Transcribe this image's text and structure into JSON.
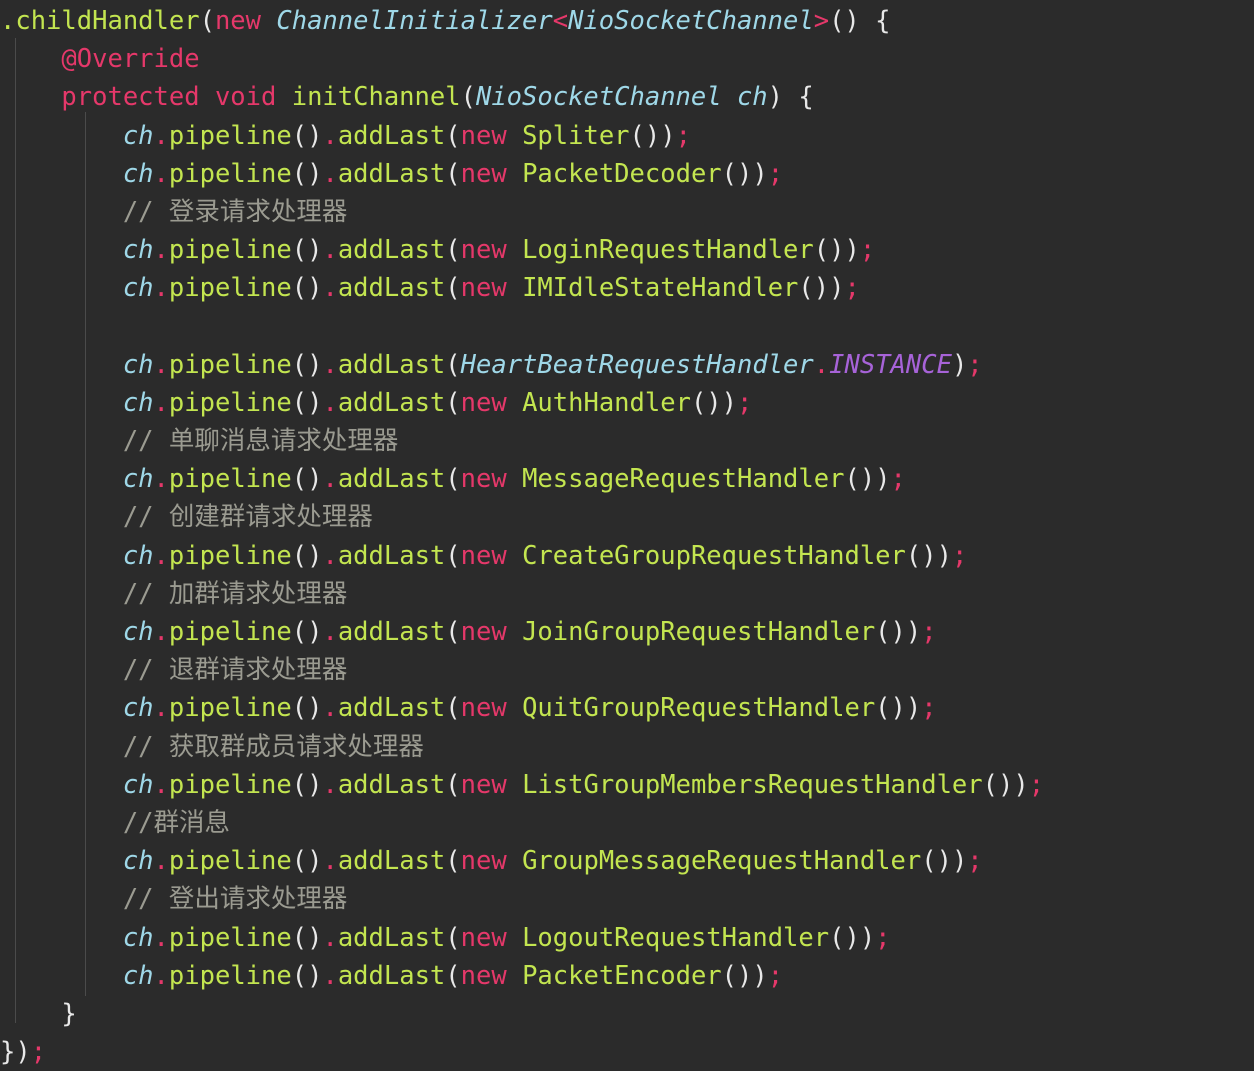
{
  "editor": {
    "theme": "dark",
    "language": "java",
    "background_color": "#2b2b2b",
    "indent_guide_color": "#4b4b4b",
    "colors": {
      "punctuation": "#e8e8e8",
      "keyword": "#e5386a",
      "method": "#c3e550",
      "type": "#9fd8e8",
      "variable": "#9fd8e8",
      "comment": "#9b9b91",
      "constant": "#a763d8",
      "semicolon": "#e5386a"
    }
  },
  "code": {
    "lines": [
      {
        "n": 1,
        "text": ".childHandler(new ChannelInitializer<NioSocketChannel>() {",
        "tokens": [
          {
            "t": ".childHandler",
            "c": "mth"
          },
          {
            "t": "(",
            "c": "pun"
          },
          {
            "t": "new ",
            "c": "kw"
          },
          {
            "t": "ChannelInitializer",
            "c": "typ"
          },
          {
            "t": "<",
            "c": "semi"
          },
          {
            "t": "NioSocketChannel",
            "c": "typ"
          },
          {
            "t": ">",
            "c": "semi"
          },
          {
            "t": "() {",
            "c": "pun"
          }
        ]
      },
      {
        "n": 2,
        "text": "    @Override",
        "tokens": [
          {
            "t": "    ",
            "c": "pun"
          },
          {
            "t": "@Override",
            "c": "ann"
          }
        ]
      },
      {
        "n": 3,
        "text": "    protected void initChannel(NioSocketChannel ch) {",
        "tokens": [
          {
            "t": "    ",
            "c": "pun"
          },
          {
            "t": "protected void ",
            "c": "kw"
          },
          {
            "t": "initChannel",
            "c": "mth"
          },
          {
            "t": "(",
            "c": "pun"
          },
          {
            "t": "NioSocketChannel ch",
            "c": "typ"
          },
          {
            "t": ") {",
            "c": "pun"
          }
        ]
      },
      {
        "n": 4,
        "text": "        ch.pipeline().addLast(new Spliter());",
        "tokens": [
          {
            "t": "        ",
            "c": "pun"
          },
          {
            "t": "ch",
            "c": "var"
          },
          {
            "t": ".",
            "c": "dot"
          },
          {
            "t": "pipeline",
            "c": "mth"
          },
          {
            "t": "()",
            "c": "pun"
          },
          {
            "t": ".",
            "c": "dot"
          },
          {
            "t": "addLast",
            "c": "mth"
          },
          {
            "t": "(",
            "c": "pun"
          },
          {
            "t": "new ",
            "c": "kw"
          },
          {
            "t": "Spliter",
            "c": "mth"
          },
          {
            "t": "())",
            "c": "pun"
          },
          {
            "t": ";",
            "c": "semi"
          }
        ]
      },
      {
        "n": 5,
        "text": "        ch.pipeline().addLast(new PacketDecoder());",
        "tokens": [
          {
            "t": "        ",
            "c": "pun"
          },
          {
            "t": "ch",
            "c": "var"
          },
          {
            "t": ".",
            "c": "dot"
          },
          {
            "t": "pipeline",
            "c": "mth"
          },
          {
            "t": "()",
            "c": "pun"
          },
          {
            "t": ".",
            "c": "dot"
          },
          {
            "t": "addLast",
            "c": "mth"
          },
          {
            "t": "(",
            "c": "pun"
          },
          {
            "t": "new ",
            "c": "kw"
          },
          {
            "t": "PacketDecoder",
            "c": "mth"
          },
          {
            "t": "())",
            "c": "pun"
          },
          {
            "t": ";",
            "c": "semi"
          }
        ]
      },
      {
        "n": 6,
        "text": "        // 登录请求处理器",
        "tokens": [
          {
            "t": "        ",
            "c": "pun"
          },
          {
            "t": "// ",
            "c": "cmt"
          },
          {
            "t": "登录请求处理器",
            "c": "cmt cn-cmt"
          }
        ]
      },
      {
        "n": 7,
        "text": "        ch.pipeline().addLast(new LoginRequestHandler());",
        "tokens": [
          {
            "t": "        ",
            "c": "pun"
          },
          {
            "t": "ch",
            "c": "var"
          },
          {
            "t": ".",
            "c": "dot"
          },
          {
            "t": "pipeline",
            "c": "mth"
          },
          {
            "t": "()",
            "c": "pun"
          },
          {
            "t": ".",
            "c": "dot"
          },
          {
            "t": "addLast",
            "c": "mth"
          },
          {
            "t": "(",
            "c": "pun"
          },
          {
            "t": "new ",
            "c": "kw"
          },
          {
            "t": "LoginRequestHandler",
            "c": "mth"
          },
          {
            "t": "())",
            "c": "pun"
          },
          {
            "t": ";",
            "c": "semi"
          }
        ]
      },
      {
        "n": 8,
        "text": "        ch.pipeline().addLast(new IMIdleStateHandler());",
        "tokens": [
          {
            "t": "        ",
            "c": "pun"
          },
          {
            "t": "ch",
            "c": "var"
          },
          {
            "t": ".",
            "c": "dot"
          },
          {
            "t": "pipeline",
            "c": "mth"
          },
          {
            "t": "()",
            "c": "pun"
          },
          {
            "t": ".",
            "c": "dot"
          },
          {
            "t": "addLast",
            "c": "mth"
          },
          {
            "t": "(",
            "c": "pun"
          },
          {
            "t": "new ",
            "c": "kw"
          },
          {
            "t": "IMIdleStateHandler",
            "c": "mth"
          },
          {
            "t": "())",
            "c": "pun"
          },
          {
            "t": ";",
            "c": "semi"
          }
        ]
      },
      {
        "n": 9,
        "text": "",
        "tokens": []
      },
      {
        "n": 10,
        "text": "        ch.pipeline().addLast(HeartBeatRequestHandler.INSTANCE);",
        "tokens": [
          {
            "t": "        ",
            "c": "pun"
          },
          {
            "t": "ch",
            "c": "var"
          },
          {
            "t": ".",
            "c": "dot"
          },
          {
            "t": "pipeline",
            "c": "mth"
          },
          {
            "t": "()",
            "c": "pun"
          },
          {
            "t": ".",
            "c": "dot"
          },
          {
            "t": "addLast",
            "c": "mth"
          },
          {
            "t": "(",
            "c": "pun"
          },
          {
            "t": "HeartBeatRequestHandler",
            "c": "typ"
          },
          {
            "t": ".",
            "c": "dot"
          },
          {
            "t": "INSTANCE",
            "c": "const"
          },
          {
            "t": ")",
            "c": "pun"
          },
          {
            "t": ";",
            "c": "semi"
          }
        ]
      },
      {
        "n": 11,
        "text": "        ch.pipeline().addLast(new AuthHandler());",
        "tokens": [
          {
            "t": "        ",
            "c": "pun"
          },
          {
            "t": "ch",
            "c": "var"
          },
          {
            "t": ".",
            "c": "dot"
          },
          {
            "t": "pipeline",
            "c": "mth"
          },
          {
            "t": "()",
            "c": "pun"
          },
          {
            "t": ".",
            "c": "dot"
          },
          {
            "t": "addLast",
            "c": "mth"
          },
          {
            "t": "(",
            "c": "pun"
          },
          {
            "t": "new ",
            "c": "kw"
          },
          {
            "t": "AuthHandler",
            "c": "mth"
          },
          {
            "t": "())",
            "c": "pun"
          },
          {
            "t": ";",
            "c": "semi"
          }
        ]
      },
      {
        "n": 12,
        "text": "        // 单聊消息请求处理器",
        "tokens": [
          {
            "t": "        ",
            "c": "pun"
          },
          {
            "t": "// ",
            "c": "cmt"
          },
          {
            "t": "单聊消息请求处理器",
            "c": "cmt cn-cmt"
          }
        ]
      },
      {
        "n": 13,
        "text": "        ch.pipeline().addLast(new MessageRequestHandler());",
        "tokens": [
          {
            "t": "        ",
            "c": "pun"
          },
          {
            "t": "ch",
            "c": "var"
          },
          {
            "t": ".",
            "c": "dot"
          },
          {
            "t": "pipeline",
            "c": "mth"
          },
          {
            "t": "()",
            "c": "pun"
          },
          {
            "t": ".",
            "c": "dot"
          },
          {
            "t": "addLast",
            "c": "mth"
          },
          {
            "t": "(",
            "c": "pun"
          },
          {
            "t": "new ",
            "c": "kw"
          },
          {
            "t": "MessageRequestHandler",
            "c": "mth"
          },
          {
            "t": "())",
            "c": "pun"
          },
          {
            "t": ";",
            "c": "semi"
          }
        ]
      },
      {
        "n": 14,
        "text": "        // 创建群请求处理器",
        "tokens": [
          {
            "t": "        ",
            "c": "pun"
          },
          {
            "t": "// ",
            "c": "cmt"
          },
          {
            "t": "创建群请求处理器",
            "c": "cmt cn-cmt"
          }
        ]
      },
      {
        "n": 15,
        "text": "        ch.pipeline().addLast(new CreateGroupRequestHandler());",
        "tokens": [
          {
            "t": "        ",
            "c": "pun"
          },
          {
            "t": "ch",
            "c": "var"
          },
          {
            "t": ".",
            "c": "dot"
          },
          {
            "t": "pipeline",
            "c": "mth"
          },
          {
            "t": "()",
            "c": "pun"
          },
          {
            "t": ".",
            "c": "dot"
          },
          {
            "t": "addLast",
            "c": "mth"
          },
          {
            "t": "(",
            "c": "pun"
          },
          {
            "t": "new ",
            "c": "kw"
          },
          {
            "t": "CreateGroupRequestHandler",
            "c": "mth"
          },
          {
            "t": "())",
            "c": "pun"
          },
          {
            "t": ";",
            "c": "semi"
          }
        ]
      },
      {
        "n": 16,
        "text": "        // 加群请求处理器",
        "tokens": [
          {
            "t": "        ",
            "c": "pun"
          },
          {
            "t": "// ",
            "c": "cmt"
          },
          {
            "t": "加群请求处理器",
            "c": "cmt cn-cmt"
          }
        ]
      },
      {
        "n": 17,
        "text": "        ch.pipeline().addLast(new JoinGroupRequestHandler());",
        "tokens": [
          {
            "t": "        ",
            "c": "pun"
          },
          {
            "t": "ch",
            "c": "var"
          },
          {
            "t": ".",
            "c": "dot"
          },
          {
            "t": "pipeline",
            "c": "mth"
          },
          {
            "t": "()",
            "c": "pun"
          },
          {
            "t": ".",
            "c": "dot"
          },
          {
            "t": "addLast",
            "c": "mth"
          },
          {
            "t": "(",
            "c": "pun"
          },
          {
            "t": "new ",
            "c": "kw"
          },
          {
            "t": "JoinGroupRequestHandler",
            "c": "mth"
          },
          {
            "t": "())",
            "c": "pun"
          },
          {
            "t": ";",
            "c": "semi"
          }
        ]
      },
      {
        "n": 18,
        "text": "        // 退群请求处理器",
        "tokens": [
          {
            "t": "        ",
            "c": "pun"
          },
          {
            "t": "// ",
            "c": "cmt"
          },
          {
            "t": "退群请求处理器",
            "c": "cmt cn-cmt"
          }
        ]
      },
      {
        "n": 19,
        "text": "        ch.pipeline().addLast(new QuitGroupRequestHandler());",
        "tokens": [
          {
            "t": "        ",
            "c": "pun"
          },
          {
            "t": "ch",
            "c": "var"
          },
          {
            "t": ".",
            "c": "dot"
          },
          {
            "t": "pipeline",
            "c": "mth"
          },
          {
            "t": "()",
            "c": "pun"
          },
          {
            "t": ".",
            "c": "dot"
          },
          {
            "t": "addLast",
            "c": "mth"
          },
          {
            "t": "(",
            "c": "pun"
          },
          {
            "t": "new ",
            "c": "kw"
          },
          {
            "t": "QuitGroupRequestHandler",
            "c": "mth"
          },
          {
            "t": "())",
            "c": "pun"
          },
          {
            "t": ";",
            "c": "semi"
          }
        ]
      },
      {
        "n": 20,
        "text": "        // 获取群成员请求处理器",
        "tokens": [
          {
            "t": "        ",
            "c": "pun"
          },
          {
            "t": "// ",
            "c": "cmt"
          },
          {
            "t": "获取群成员请求处理器",
            "c": "cmt cn-cmt"
          }
        ]
      },
      {
        "n": 21,
        "text": "        ch.pipeline().addLast(new ListGroupMembersRequestHandler());",
        "tokens": [
          {
            "t": "        ",
            "c": "pun"
          },
          {
            "t": "ch",
            "c": "var"
          },
          {
            "t": ".",
            "c": "dot"
          },
          {
            "t": "pipeline",
            "c": "mth"
          },
          {
            "t": "()",
            "c": "pun"
          },
          {
            "t": ".",
            "c": "dot"
          },
          {
            "t": "addLast",
            "c": "mth"
          },
          {
            "t": "(",
            "c": "pun"
          },
          {
            "t": "new ",
            "c": "kw"
          },
          {
            "t": "ListGroupMembersRequestHandler",
            "c": "mth"
          },
          {
            "t": "())",
            "c": "pun"
          },
          {
            "t": ";",
            "c": "semi"
          }
        ]
      },
      {
        "n": 22,
        "text": "        //群消息",
        "tokens": [
          {
            "t": "        ",
            "c": "pun"
          },
          {
            "t": "//",
            "c": "cmt"
          },
          {
            "t": "群消息",
            "c": "cmt cn-cmt"
          }
        ]
      },
      {
        "n": 23,
        "text": "        ch.pipeline().addLast(new GroupMessageRequestHandler());",
        "tokens": [
          {
            "t": "        ",
            "c": "pun"
          },
          {
            "t": "ch",
            "c": "var"
          },
          {
            "t": ".",
            "c": "dot"
          },
          {
            "t": "pipeline",
            "c": "mth"
          },
          {
            "t": "()",
            "c": "pun"
          },
          {
            "t": ".",
            "c": "dot"
          },
          {
            "t": "addLast",
            "c": "mth"
          },
          {
            "t": "(",
            "c": "pun"
          },
          {
            "t": "new ",
            "c": "kw"
          },
          {
            "t": "GroupMessageRequestHandler",
            "c": "mth"
          },
          {
            "t": "())",
            "c": "pun"
          },
          {
            "t": ";",
            "c": "semi"
          }
        ]
      },
      {
        "n": 24,
        "text": "        // 登出请求处理器",
        "tokens": [
          {
            "t": "        ",
            "c": "pun"
          },
          {
            "t": "// ",
            "c": "cmt"
          },
          {
            "t": "登出请求处理器",
            "c": "cmt cn-cmt"
          }
        ]
      },
      {
        "n": 25,
        "text": "        ch.pipeline().addLast(new LogoutRequestHandler());",
        "tokens": [
          {
            "t": "        ",
            "c": "pun"
          },
          {
            "t": "ch",
            "c": "var"
          },
          {
            "t": ".",
            "c": "dot"
          },
          {
            "t": "pipeline",
            "c": "mth"
          },
          {
            "t": "()",
            "c": "pun"
          },
          {
            "t": ".",
            "c": "dot"
          },
          {
            "t": "addLast",
            "c": "mth"
          },
          {
            "t": "(",
            "c": "pun"
          },
          {
            "t": "new ",
            "c": "kw"
          },
          {
            "t": "LogoutRequestHandler",
            "c": "mth"
          },
          {
            "t": "())",
            "c": "pun"
          },
          {
            "t": ";",
            "c": "semi"
          }
        ]
      },
      {
        "n": 26,
        "text": "        ch.pipeline().addLast(new PacketEncoder());",
        "tokens": [
          {
            "t": "        ",
            "c": "pun"
          },
          {
            "t": "ch",
            "c": "var"
          },
          {
            "t": ".",
            "c": "dot"
          },
          {
            "t": "pipeline",
            "c": "mth"
          },
          {
            "t": "()",
            "c": "pun"
          },
          {
            "t": ".",
            "c": "dot"
          },
          {
            "t": "addLast",
            "c": "mth"
          },
          {
            "t": "(",
            "c": "pun"
          },
          {
            "t": "new ",
            "c": "kw"
          },
          {
            "t": "PacketEncoder",
            "c": "mth"
          },
          {
            "t": "())",
            "c": "pun"
          },
          {
            "t": ";",
            "c": "semi"
          }
        ]
      },
      {
        "n": 27,
        "text": "    }",
        "tokens": [
          {
            "t": "    }",
            "c": "pun"
          }
        ]
      },
      {
        "n": 28,
        "text": "});",
        "tokens": [
          {
            "t": "})",
            "c": "pun"
          },
          {
            "t": ";",
            "c": "semi"
          }
        ]
      }
    ]
  }
}
